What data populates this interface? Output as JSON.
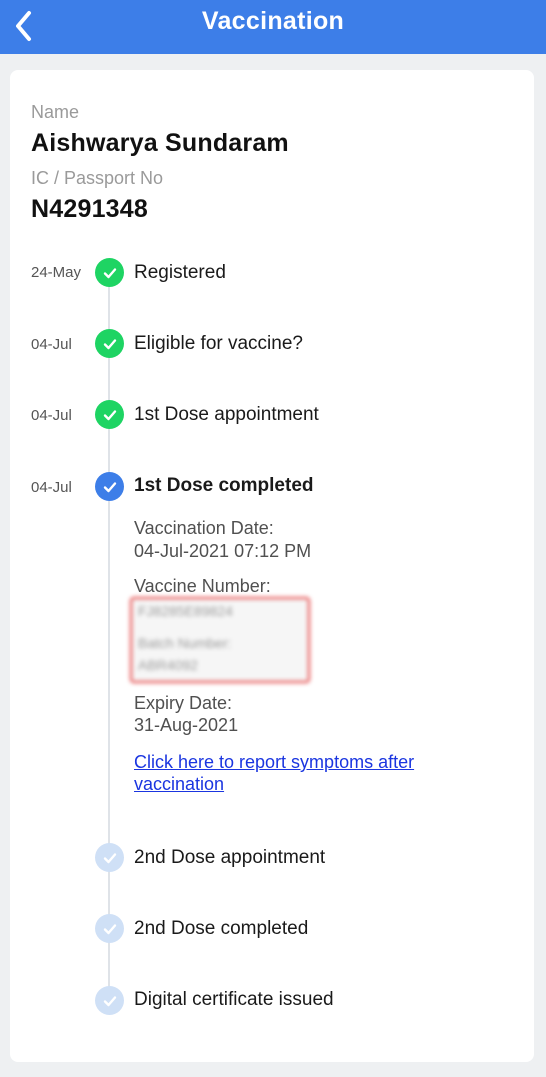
{
  "header": {
    "title": "Vaccination",
    "back_icon": "chevron-left-icon"
  },
  "profile": {
    "name_label": "Name",
    "name": "Aishwarya Sundaram",
    "id_label": "IC / Passport No",
    "id": "N4291348"
  },
  "colors": {
    "accent": "#3d7ee8",
    "done": "#1ed463",
    "pending": "#cfe0f6",
    "link": "#1a35e0"
  },
  "timeline": [
    {
      "date": "24-May",
      "label": "Registered",
      "status": "done"
    },
    {
      "date": "04-Jul",
      "label": "Eligible for vaccine?",
      "status": "done"
    },
    {
      "date": "04-Jul",
      "label": "1st Dose appointment",
      "status": "done"
    },
    {
      "date": "04-Jul",
      "label": "1st Dose completed",
      "status": "current"
    },
    {
      "date": "",
      "label": "2nd Dose appointment",
      "status": "pending"
    },
    {
      "date": "",
      "label": "2nd Dose completed",
      "status": "pending"
    },
    {
      "date": "",
      "label": "Digital certificate issued",
      "status": "pending"
    }
  ],
  "dose1": {
    "date_label": "Vaccination Date:",
    "date_value": "04-Jul-2021 07:12 PM",
    "number_label": "Vaccine Number:",
    "redacted_number": "FJ8285E89824",
    "redacted_batch_label": "Batch Number:",
    "redacted_batch": "ABR4092",
    "expiry_label": "Expiry Date:",
    "expiry_value": "31-Aug-2021",
    "report_link": "Click here to report symptoms after vaccination"
  }
}
